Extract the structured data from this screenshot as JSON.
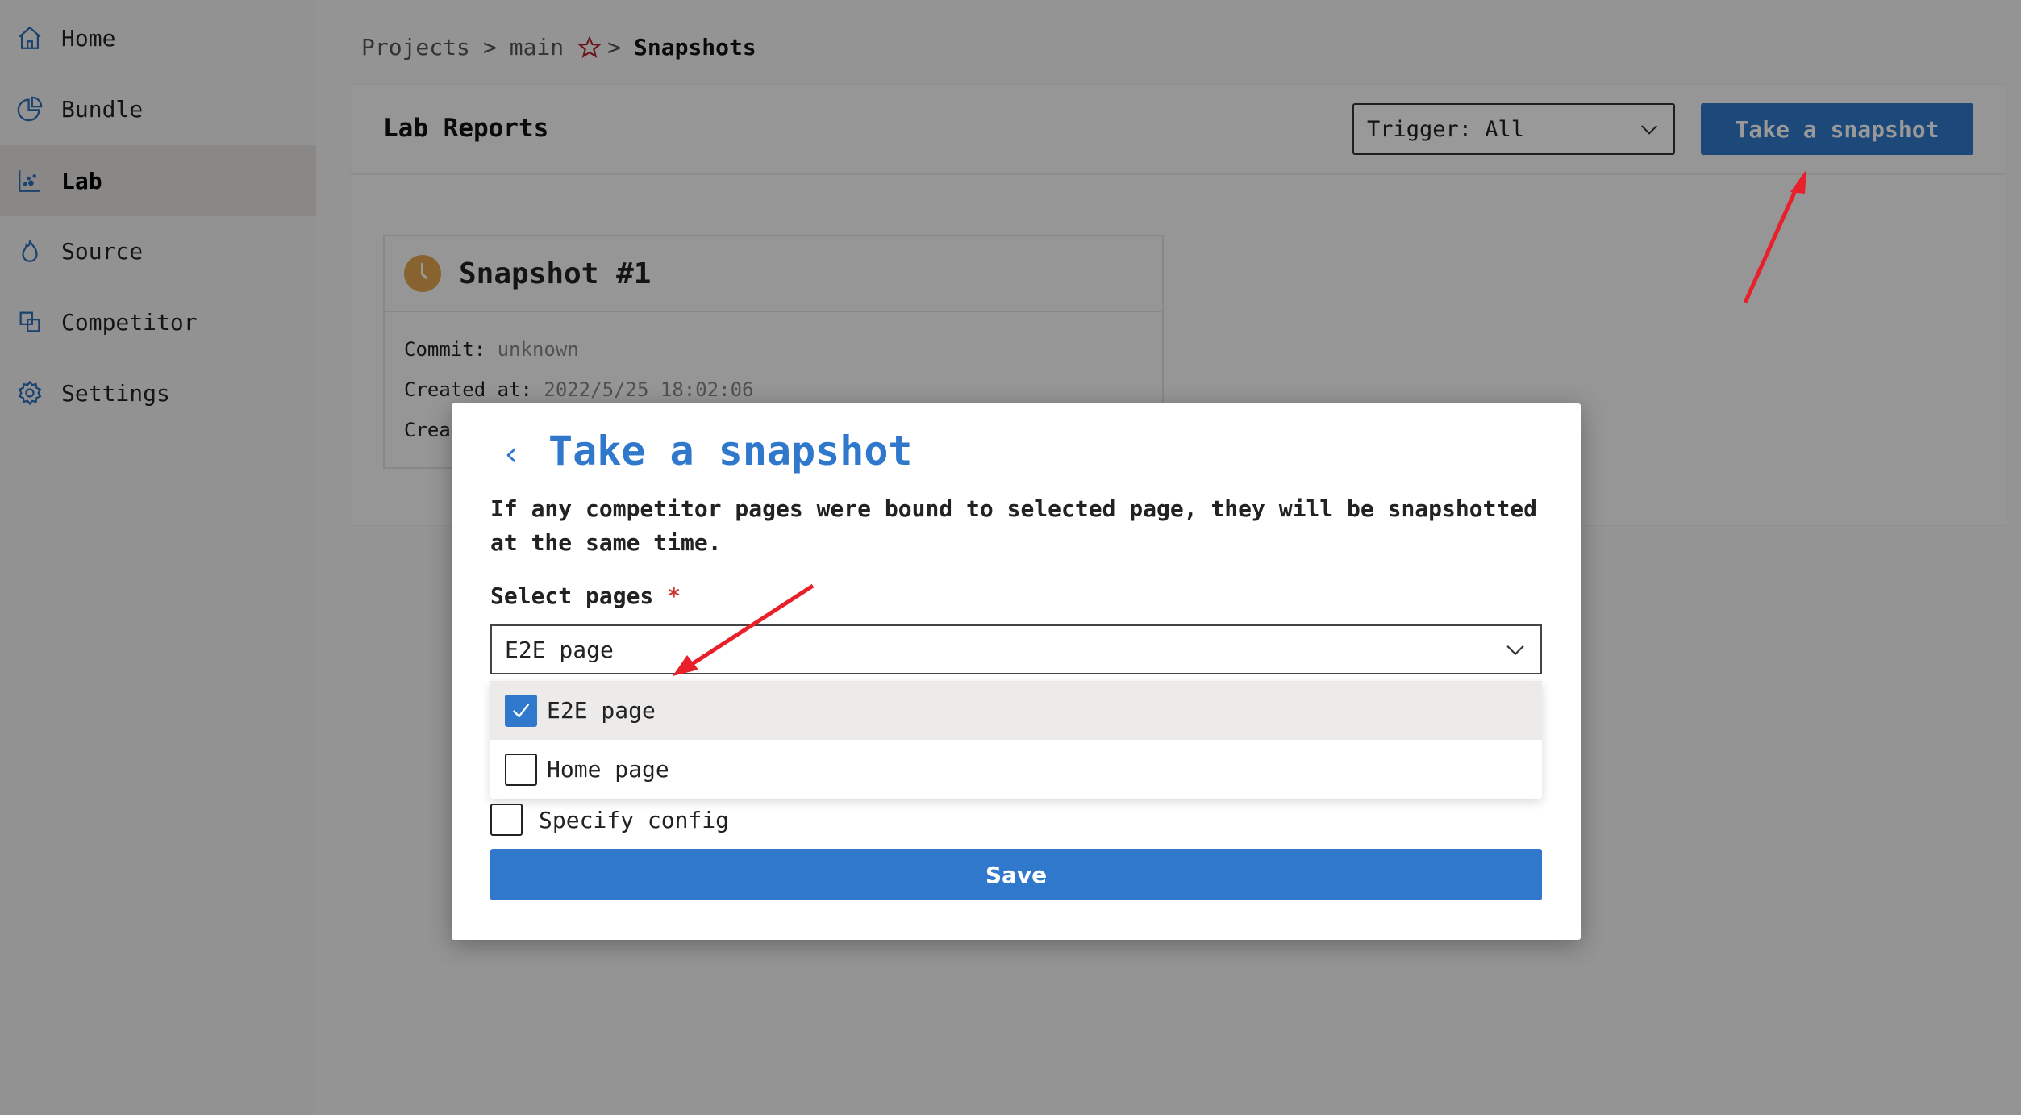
{
  "sidebar": {
    "items": [
      {
        "label": "Home",
        "icon": "home-icon"
      },
      {
        "label": "Bundle",
        "icon": "pie-chart-icon"
      },
      {
        "label": "Lab",
        "icon": "scatter-chart-icon",
        "active": true
      },
      {
        "label": "Source",
        "icon": "flame-icon"
      },
      {
        "label": "Competitor",
        "icon": "overlap-squares-icon"
      },
      {
        "label": "Settings",
        "icon": "gear-icon"
      }
    ]
  },
  "breadcrumb": {
    "items": [
      "Projects",
      "main",
      "Snapshots"
    ],
    "separator": ">",
    "star_icon": "star-icon"
  },
  "panel": {
    "title": "Lab Reports",
    "trigger_select": "Trigger: All",
    "take_snapshot_label": "Take a snapshot"
  },
  "snapshot_card": {
    "title": "Snapshot #1",
    "status_icon": "clock-icon",
    "commit_label": "Commit:",
    "commit_value": "unknown",
    "created_at_label": "Created at:",
    "created_at_value": "2022/5/25 18:02:06",
    "third_line_partial": "Crea"
  },
  "modal": {
    "back_icon": "chevron-left-icon",
    "title": "Take a snapshot",
    "description": "If any competitor pages were bound to selected page, they will be snapshotted at the same time.",
    "select_label": "Select pages",
    "required_mark": "*",
    "select_value": "E2E page",
    "options": [
      {
        "label": "E2E page",
        "checked": true
      },
      {
        "label": "Home page",
        "checked": false
      }
    ],
    "specify_config_label": "Specify config",
    "specify_config_checked": false,
    "save_label": "Save"
  },
  "colors": {
    "primary": "#2f78cc",
    "annotation_arrow": "#e8202a",
    "clock_badge": "#e3a64f"
  }
}
